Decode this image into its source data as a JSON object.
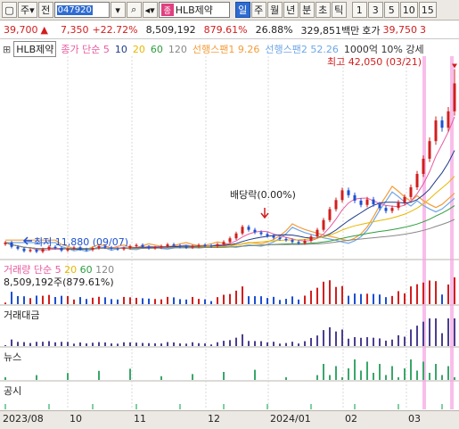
{
  "toolbar": {
    "type_label": "주",
    "sheet_label": "전",
    "code": "047920",
    "search_icon": "search-icon",
    "name_badge": "종",
    "name": "HLB제약",
    "periods": [
      "일",
      "주",
      "월",
      "년",
      "분",
      "초",
      "틱"
    ],
    "active_period": "일",
    "intervals": [
      "1",
      "3",
      "5",
      "10",
      "15"
    ]
  },
  "quote": {
    "price": "39,700",
    "arrow": "▲",
    "change": "7,350",
    "change_pct": "+22.72%",
    "volume": "8,509,192",
    "vol_ratio": "879.61%",
    "turnover": "26.88%",
    "amount": "329,851백만",
    "ask_label": "호가",
    "ask": "39,750",
    "tail": "3"
  },
  "legend": {
    "name": "HLB제약",
    "ma_label": "종가 단순 5",
    "ma": [
      "10",
      "20",
      "60",
      "120"
    ],
    "span1": "선행스팬1 9.26",
    "span2": "선행스팬2 52.26",
    "extra": "1000억 10% 강세"
  },
  "annotations": {
    "high": "최고 42,050 (03/21)",
    "dividend": "배당락(0.00%)",
    "low": "최저 11,880 (09/07)"
  },
  "panes": {
    "volume_title": "거래량 단순 5",
    "volume_ma": [
      "20",
      "60",
      "120"
    ],
    "volume_value": "8,509,192주(879.61%)",
    "amount_title": "거래대금",
    "news_title": "뉴스",
    "disclosure_title": "공시"
  },
  "xaxis": [
    "2023/08",
    "10",
    "11",
    "12",
    "2024/01",
    "02",
    "03"
  ],
  "colors": {
    "up": "#d21e1e",
    "down": "#1e4fd2",
    "ma5": "#e85aa0",
    "ma10": "#1e3a8a",
    "ma20": "#e6b800",
    "ma60": "#2e9e3e",
    "ma120": "#888888",
    "span1": "#f29d3a",
    "span2": "#6ea6e6",
    "highlight": "#f5a3e3",
    "news": "#3aa66a",
    "amount": "#4a3f8f"
  },
  "chart_data": {
    "type": "candlestick",
    "period_labels": [
      "2023/08",
      "10",
      "11",
      "12",
      "2024/01",
      "02",
      "03"
    ],
    "close_approx": [
      13500,
      12800,
      12500,
      12100,
      12300,
      12000,
      12400,
      12800,
      12600,
      12200,
      12500,
      12700,
      12400,
      12300,
      12600,
      12900,
      12700,
      12500,
      12400,
      12600,
      12900,
      13100,
      12800,
      12600,
      12700,
      12900,
      13200,
      13000,
      12800,
      12700,
      12900,
      13100,
      13000,
      12900,
      13200,
      13600,
      14200,
      15000,
      16100,
      15600,
      15200,
      14900,
      14600,
      14300,
      14100,
      13900,
      13600,
      13400,
      13800,
      14500,
      15600,
      17200,
      19000,
      20500,
      22100,
      21300,
      20400,
      19700,
      20600,
      19800,
      19200,
      18700,
      19200,
      20100,
      21000,
      22600,
      24800,
      27300,
      30200,
      33600,
      32400,
      35100,
      39700
    ],
    "high": 42050,
    "high_date": "03/21",
    "low": 11880,
    "low_date": "09/07"
  }
}
